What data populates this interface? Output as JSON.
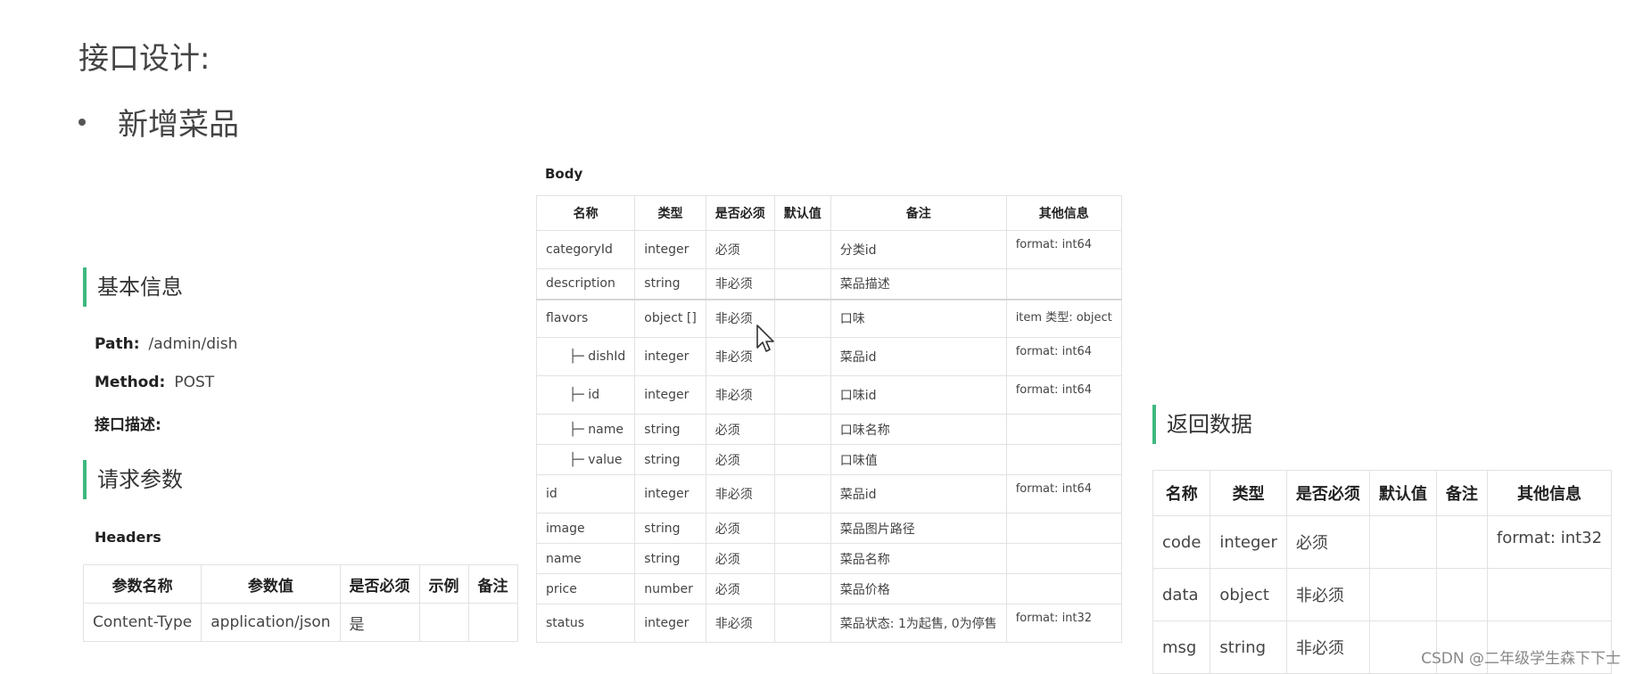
{
  "title": "接口设计:",
  "bullet": "新增菜品",
  "basic": {
    "heading": "基本信息",
    "path_label": "Path:",
    "path_value": "/admin/dish",
    "method_label": "Method:",
    "method_value": "POST",
    "desc_label": "接口描述:"
  },
  "request": {
    "heading": "请求参数",
    "headers_label": "Headers",
    "headers_columns": [
      "参数名称",
      "参数值",
      "是否必须",
      "示例",
      "备注"
    ],
    "headers_rows": [
      [
        "Content-Type",
        "application/json",
        "是",
        "",
        ""
      ]
    ]
  },
  "body": {
    "label": "Body",
    "columns": [
      "名称",
      "类型",
      "是否必须",
      "默认值",
      "备注",
      "其他信息"
    ],
    "rows": [
      [
        "categoryId",
        "integer",
        "必须",
        "",
        "分类id",
        "format: int64"
      ],
      [
        "description",
        "string",
        "非必须",
        "",
        "菜品描述",
        ""
      ],
      [
        "flavors",
        "object []",
        "非必须",
        "",
        "口味",
        "item 类型: object"
      ],
      [
        "├─ dishId",
        "integer",
        "非必须",
        "",
        "菜品id",
        "format: int64"
      ],
      [
        "├─ id",
        "integer",
        "非必须",
        "",
        "口味id",
        "format: int64"
      ],
      [
        "├─ name",
        "string",
        "必须",
        "",
        "口味名称",
        ""
      ],
      [
        "├─ value",
        "string",
        "必须",
        "",
        "口味值",
        ""
      ],
      [
        "id",
        "integer",
        "非必须",
        "",
        "菜品id",
        "format: int64"
      ],
      [
        "image",
        "string",
        "必须",
        "",
        "菜品图片路径",
        ""
      ],
      [
        "name",
        "string",
        "必须",
        "",
        "菜品名称",
        ""
      ],
      [
        "price",
        "number",
        "必须",
        "",
        "菜品价格",
        ""
      ],
      [
        "status",
        "integer",
        "非必须",
        "",
        "菜品状态: 1为起售, 0为停售",
        "format: int32"
      ]
    ]
  },
  "response": {
    "heading": "返回数据",
    "columns": [
      "名称",
      "类型",
      "是否必须",
      "默认值",
      "备注",
      "其他信息"
    ],
    "rows": [
      [
        "code",
        "integer",
        "必须",
        "",
        "",
        "format: int32"
      ],
      [
        "data",
        "object",
        "非必须",
        "",
        "",
        ""
      ],
      [
        "msg",
        "string",
        "非必须",
        "",
        "",
        ""
      ]
    ]
  },
  "watermark": "CSDN @二年级学生森下下士",
  "colors": {
    "accent": "#3cb97f",
    "border": "#e2e2e2"
  },
  "icons": {
    "cursor": "mouse-pointer-icon"
  }
}
